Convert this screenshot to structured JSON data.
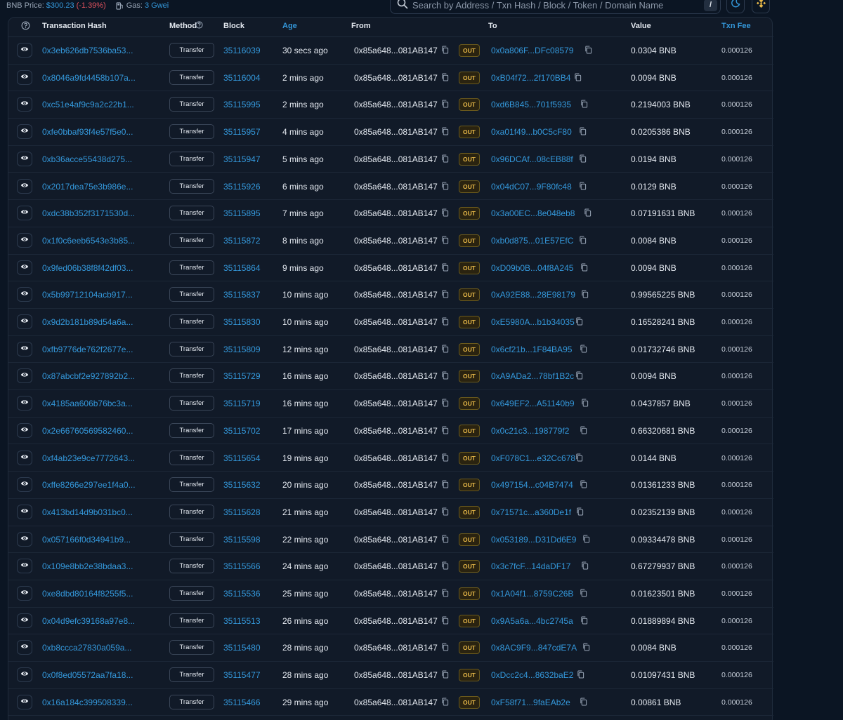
{
  "topbar": {
    "price_label": "BNB Price:",
    "price_value": "$300.23",
    "price_change": "(-1.39%)",
    "gas_label": "Gas:",
    "gas_value": "3 Gwei"
  },
  "search": {
    "placeholder": "Search by Address / Txn Hash / Block / Token / Domain Name",
    "shortcut": "/"
  },
  "columns": {
    "hash": "Transaction Hash",
    "method": "Method",
    "block": "Block",
    "age": "Age",
    "from": "From",
    "to": "To",
    "value": "Value",
    "fee": "Txn Fee"
  },
  "colors": {
    "link": "#3498db",
    "negative": "#e0525e",
    "out_badge": "#e8b949"
  },
  "rows": [
    {
      "hash": "0x3eb626db7536ba53...",
      "method": "Transfer",
      "block": "35116039",
      "age": "30 secs ago",
      "from": "0x85a648...081AB147",
      "dir": "OUT",
      "to": "0x0a806F...DFc08579",
      "value": "0.0304 BNB",
      "fee": "0.000126"
    },
    {
      "hash": "0x8046a9fd4458b107a...",
      "method": "Transfer",
      "block": "35116004",
      "age": "2 mins ago",
      "from": "0x85a648...081AB147",
      "dir": "OUT",
      "to": "0xB04f72...2f170BB4",
      "value": "0.0094 BNB",
      "fee": "0.000126"
    },
    {
      "hash": "0xc51e4af9c9a2c22b1...",
      "method": "Transfer",
      "block": "35115995",
      "age": "2 mins ago",
      "from": "0x85a648...081AB147",
      "dir": "OUT",
      "to": "0xd6B845...701f5935",
      "value": "0.2194003 BNB",
      "fee": "0.000126"
    },
    {
      "hash": "0xfe0bbaf93f4e57f5e0...",
      "method": "Transfer",
      "block": "35115957",
      "age": "4 mins ago",
      "from": "0x85a648...081AB147",
      "dir": "OUT",
      "to": "0xa01f49...b0C5cF80",
      "value": "0.0205386 BNB",
      "fee": "0.000126"
    },
    {
      "hash": "0xb36acce55438d275...",
      "method": "Transfer",
      "block": "35115947",
      "age": "5 mins ago",
      "from": "0x85a648...081AB147",
      "dir": "OUT",
      "to": "0x96DCAf...08cEB88f",
      "value": "0.0194 BNB",
      "fee": "0.000126"
    },
    {
      "hash": "0x2017dea75e3b986e...",
      "method": "Transfer",
      "block": "35115926",
      "age": "6 mins ago",
      "from": "0x85a648...081AB147",
      "dir": "OUT",
      "to": "0x04dC07...9F80fc48",
      "value": "0.0129 BNB",
      "fee": "0.000126"
    },
    {
      "hash": "0xdc38b352f3171530d...",
      "method": "Transfer",
      "block": "35115895",
      "age": "7 mins ago",
      "from": "0x85a648...081AB147",
      "dir": "OUT",
      "to": "0x3a00EC...8e048eb8",
      "value": "0.07191631 BNB",
      "fee": "0.000126"
    },
    {
      "hash": "0x1f0c6eeb6543e3b85...",
      "method": "Transfer",
      "block": "35115872",
      "age": "8 mins ago",
      "from": "0x85a648...081AB147",
      "dir": "OUT",
      "to": "0xb0d875...01E57EfC",
      "value": "0.0084 BNB",
      "fee": "0.000126"
    },
    {
      "hash": "0x9fed06b38f8f42df03...",
      "method": "Transfer",
      "block": "35115864",
      "age": "9 mins ago",
      "from": "0x85a648...081AB147",
      "dir": "OUT",
      "to": "0xD09b0B...04f8A245",
      "value": "0.0094 BNB",
      "fee": "0.000126"
    },
    {
      "hash": "0x5b99712104acb917...",
      "method": "Transfer",
      "block": "35115837",
      "age": "10 mins ago",
      "from": "0x85a648...081AB147",
      "dir": "OUT",
      "to": "0xA92E88...28E98179",
      "value": "0.99565225 BNB",
      "fee": "0.000126"
    },
    {
      "hash": "0x9d2b181b89d54a6a...",
      "method": "Transfer",
      "block": "35115830",
      "age": "10 mins ago",
      "from": "0x85a648...081AB147",
      "dir": "OUT",
      "to": "0xE5980A...b1b34035",
      "value": "0.16528241 BNB",
      "fee": "0.000126"
    },
    {
      "hash": "0xfb9776de762f2677e...",
      "method": "Transfer",
      "block": "35115809",
      "age": "12 mins ago",
      "from": "0x85a648...081AB147",
      "dir": "OUT",
      "to": "0x6cf21b...1F84BA95",
      "value": "0.01732746 BNB",
      "fee": "0.000126"
    },
    {
      "hash": "0x87abcbf2e927892b2...",
      "method": "Transfer",
      "block": "35115729",
      "age": "16 mins ago",
      "from": "0x85a648...081AB147",
      "dir": "OUT",
      "to": "0xA9ADa2...78bf1B2c",
      "value": "0.0094 BNB",
      "fee": "0.000126"
    },
    {
      "hash": "0x4185aa606b76bc3a...",
      "method": "Transfer",
      "block": "35115719",
      "age": "16 mins ago",
      "from": "0x85a648...081AB147",
      "dir": "OUT",
      "to": "0x649EF2...A51140b9",
      "value": "0.0437857 BNB",
      "fee": "0.000126"
    },
    {
      "hash": "0x2e66760569582460...",
      "method": "Transfer",
      "block": "35115702",
      "age": "17 mins ago",
      "from": "0x85a648...081AB147",
      "dir": "OUT",
      "to": "0x0c21c3...198779f2",
      "value": "0.66320681 BNB",
      "fee": "0.000126"
    },
    {
      "hash": "0xf4ab23e9ce7772643...",
      "method": "Transfer",
      "block": "35115654",
      "age": "19 mins ago",
      "from": "0x85a648...081AB147",
      "dir": "OUT",
      "to": "0xF078C1...e32Cc678",
      "value": "0.0144 BNB",
      "fee": "0.000126"
    },
    {
      "hash": "0xffe8266e297ee1f4a0...",
      "method": "Transfer",
      "block": "35115632",
      "age": "20 mins ago",
      "from": "0x85a648...081AB147",
      "dir": "OUT",
      "to": "0x497154...c04B7474",
      "value": "0.01361233 BNB",
      "fee": "0.000126"
    },
    {
      "hash": "0x413bd14d9b031bc0...",
      "method": "Transfer",
      "block": "35115628",
      "age": "21 mins ago",
      "from": "0x85a648...081AB147",
      "dir": "OUT",
      "to": "0x71571c...a360De1f",
      "value": "0.02352139 BNB",
      "fee": "0.000126"
    },
    {
      "hash": "0x057166f0d34941b9...",
      "method": "Transfer",
      "block": "35115598",
      "age": "22 mins ago",
      "from": "0x85a648...081AB147",
      "dir": "OUT",
      "to": "0x053189...D31Dd6E9",
      "value": "0.09334478 BNB",
      "fee": "0.000126"
    },
    {
      "hash": "0x109e8bb2e38bdaa3...",
      "method": "Transfer",
      "block": "35115566",
      "age": "24 mins ago",
      "from": "0x85a648...081AB147",
      "dir": "OUT",
      "to": "0x3c7fcF...14daDF17",
      "value": "0.67279937 BNB",
      "fee": "0.000126"
    },
    {
      "hash": "0xe8dbd80164f8255f5...",
      "method": "Transfer",
      "block": "35115536",
      "age": "25 mins ago",
      "from": "0x85a648...081AB147",
      "dir": "OUT",
      "to": "0x1A04f1...8759C26B",
      "value": "0.01623501 BNB",
      "fee": "0.000126"
    },
    {
      "hash": "0x04d9efc39168a97e8...",
      "method": "Transfer",
      "block": "35115513",
      "age": "26 mins ago",
      "from": "0x85a648...081AB147",
      "dir": "OUT",
      "to": "0x9A5a6a...4bc2745a",
      "value": "0.01889894 BNB",
      "fee": "0.000126"
    },
    {
      "hash": "0xb8ccca27830a059a...",
      "method": "Transfer",
      "block": "35115480",
      "age": "28 mins ago",
      "from": "0x85a648...081AB147",
      "dir": "OUT",
      "to": "0x8AC9F9...847cdE7A",
      "value": "0.0084 BNB",
      "fee": "0.000126"
    },
    {
      "hash": "0x0f8ed05572aa7fa18...",
      "method": "Transfer",
      "block": "35115477",
      "age": "28 mins ago",
      "from": "0x85a648...081AB147",
      "dir": "OUT",
      "to": "0xDcc2c4...8632baE2",
      "value": "0.01097431 BNB",
      "fee": "0.000126"
    },
    {
      "hash": "0x16a184c399508339...",
      "method": "Transfer",
      "block": "35115466",
      "age": "29 mins ago",
      "from": "0x85a648...081AB147",
      "dir": "OUT",
      "to": "0xF58f71...9faEAb2e",
      "value": "0.00861 BNB",
      "fee": "0.000126"
    }
  ]
}
